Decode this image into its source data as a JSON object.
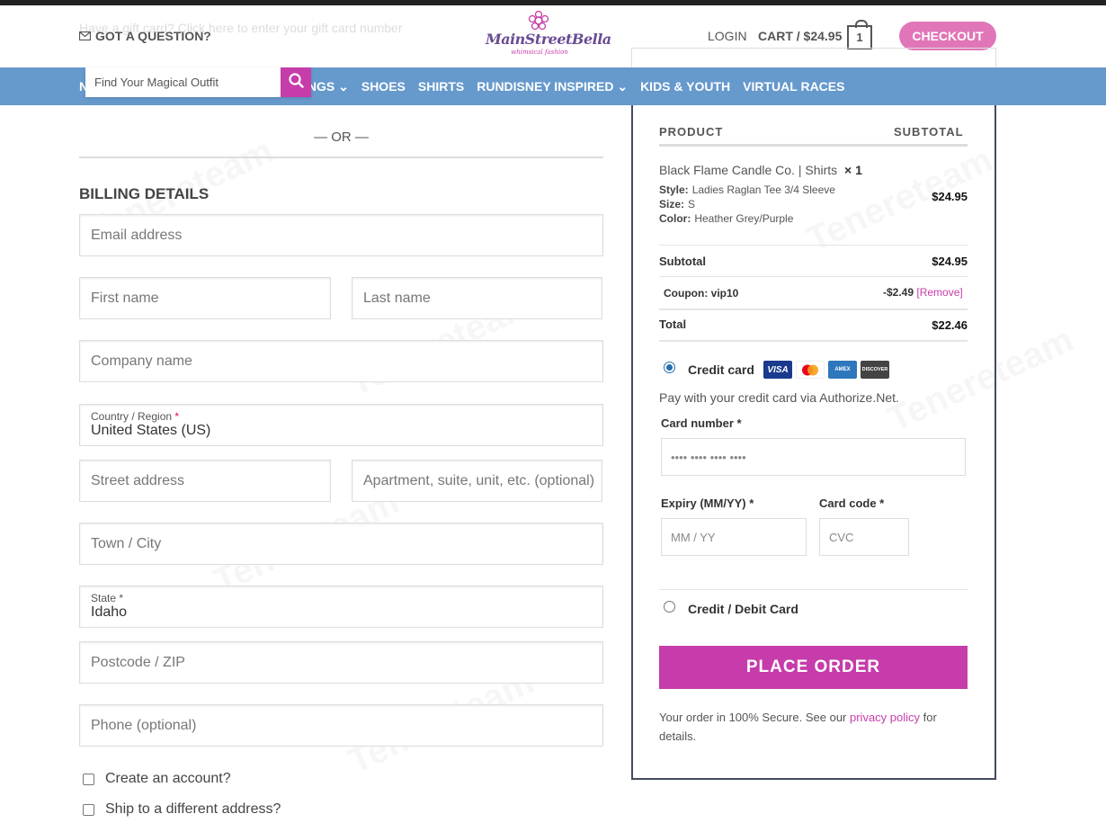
{
  "header": {
    "question": "GOT A QUESTION?",
    "ghost_text": "Have a gift card? Click here to enter your gift card number",
    "logo_brand": "MainStreetBella",
    "logo_tag": "whimsical fashion",
    "login": "LOGIN",
    "cart": "CART / $24.95",
    "cart_count": "1",
    "checkout": "CHECKOUT"
  },
  "nav": {
    "first": "N",
    "items": [
      "INGS",
      "SHOES",
      "SHIRTS",
      "RUNDISNEY INSPIRED",
      "KIDS & YOUTH",
      "VIRTUAL RACES"
    ],
    "search_placeholder": "Find Your Magical Outfit"
  },
  "form": {
    "or": "— OR —",
    "billing_title": "BILLING DETAILS",
    "email": "Email address",
    "first_name": "First name",
    "last_name": "Last name",
    "company": "Company name",
    "country_label": "Country / Region",
    "country_value": "United States (US)",
    "street": "Street address",
    "apartment": "Apartment, suite, unit, etc. (optional)",
    "city": "Town / City",
    "state_label": "State",
    "state_value": "Idaho",
    "postcode": "Postcode / ZIP",
    "phone": "Phone (optional)",
    "create_account": "Create an account?",
    "ship_different": "Ship to a different address?",
    "required_mark": "*"
  },
  "order": {
    "col_product": "PRODUCT",
    "col_subtotal": "SUBTOTAL",
    "product_name": "Black Flame Candle Co. | Shirts",
    "product_qty": "× 1",
    "style_label": "Style:",
    "style_value": "Ladies Raglan Tee 3/4 Sleeve",
    "size_label": "Size:",
    "size_value": "S",
    "color_label": "Color:",
    "color_value": "Heather Grey/Purple",
    "product_price": "$24.95",
    "subtotal_label": "Subtotal",
    "subtotal_value": "$24.95",
    "coupon_label": "Coupon: vip10",
    "coupon_value": "-$2.49",
    "coupon_remove": "[Remove]",
    "total_label": "Total",
    "total_value": "$22.46",
    "pm_credit": "Credit card",
    "pay_note": "Pay with your credit card via Authorize.Net.",
    "card_number_label": "Card number *",
    "card_number_placeholder": "•••• •••• •••• ••••",
    "expiry_label": "Expiry (MM/YY) *",
    "expiry_placeholder": "MM / YY",
    "cvc_label": "Card code *",
    "cvc_placeholder": "CVC",
    "pm_debit": "Credit / Debit Card",
    "place_order": "PLACE ORDER",
    "secure_text": "Your order in 100% Secure. See our",
    "privacy_link": "privacy policy",
    "secure_tail": "for details.",
    "cards": [
      "VISA",
      "MC",
      "AMEX",
      "DISCOVER"
    ]
  },
  "watermark": "Tenereteam",
  "colors": {
    "accent": "#c63caa",
    "nav": "#6699cc",
    "checkout": "#e076b8"
  }
}
